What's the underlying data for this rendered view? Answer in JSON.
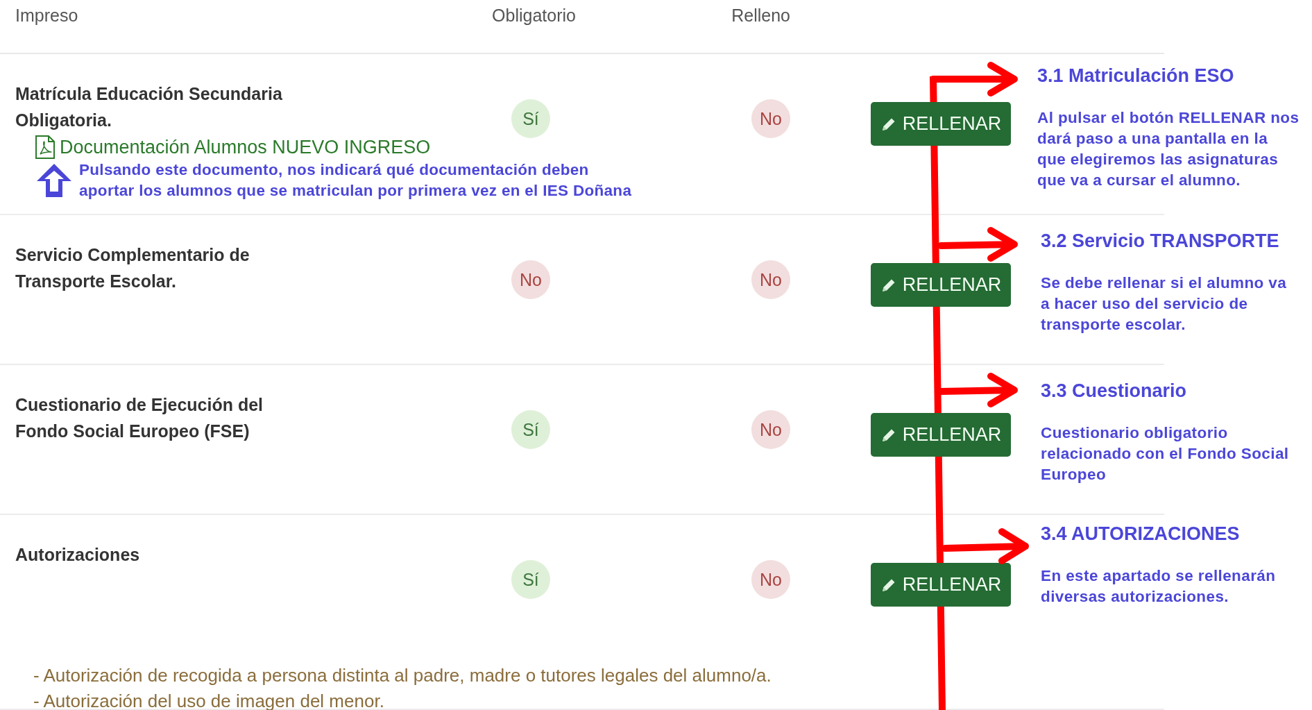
{
  "columns": [
    "Impreso",
    "Obligatorio",
    "Relleno"
  ],
  "rows": [
    {
      "title": "Matrícula Educación Secundaria Obligatoria.",
      "mandatory": {
        "text": "Sí",
        "positive": true
      },
      "filled": {
        "text": "No",
        "positive": false
      },
      "button": "RELLENAR",
      "link": "Documentación Alumnos NUEVO INGRESO",
      "note": [
        "Pulsando este documento, nos indicará qué documentación deben",
        "aportar los alumnos que se matriculan por primera vez en el IES Doñana"
      ]
    },
    {
      "title": "Servicio Complementario de Transporte Escolar.",
      "mandatory": {
        "text": "No",
        "positive": false
      },
      "filled": {
        "text": "No",
        "positive": false
      },
      "button": "RELLENAR"
    },
    {
      "title": "Cuestionario de Ejecución del Fondo Social Europeo (FSE)",
      "mandatory": {
        "text": "Sí",
        "positive": true
      },
      "filled": {
        "text": "No",
        "positive": false
      },
      "button": "RELLENAR"
    },
    {
      "title": "Autorizaciones",
      "mandatory": {
        "text": "Sí",
        "positive": true
      },
      "filled": {
        "text": "No",
        "positive": false
      },
      "button": "RELLENAR",
      "details": [
        "- Autorización de recogida a persona distinta al padre, madre o tutores legales del alumno/a.",
        "- Autorización del uso de imagen del menor."
      ]
    }
  ],
  "annotations": [
    {
      "heading": "3.1 Matriculación ESO",
      "body": [
        "Al pulsar el botón RELLENAR nos",
        "dará paso a una pantalla en la",
        "que elegiremos las asignaturas",
        "que va a cursar el alumno."
      ]
    },
    {
      "heading": "3.2 Servicio TRANSPORTE",
      "body": [
        "Se debe rellenar si el alumno va",
        "a hacer uso del servicio de",
        "transporte escolar."
      ]
    },
    {
      "heading": "3.3 Cuestionario",
      "body": [
        "Cuestionario obligatorio",
        "relacionado con el Fondo Social",
        "Europeo"
      ]
    },
    {
      "heading": "3.4 AUTORIZACIONES",
      "body": [
        "En este apartado se rellenarán",
        "diversas autorizaciones."
      ]
    }
  ]
}
